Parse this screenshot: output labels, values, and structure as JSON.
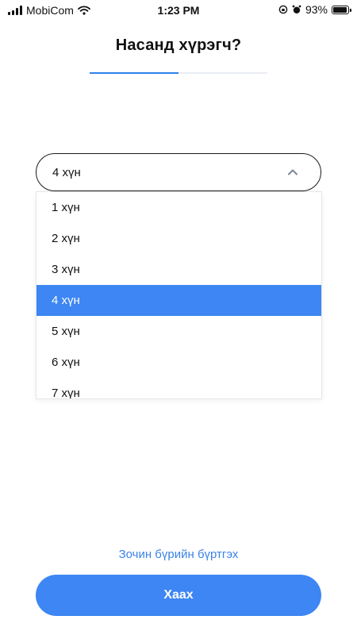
{
  "status_bar": {
    "carrier": "MobiCom",
    "time": "1:23 PM",
    "battery_percent": "93%",
    "battery_level": 0.93,
    "icons": [
      "signal-icon",
      "wifi-icon",
      "orientation-lock-icon",
      "alarm-icon",
      "battery-icon"
    ]
  },
  "header": {
    "title": "Насанд хүрэгч?",
    "progress_fraction": 0.5
  },
  "select": {
    "selected_value": "4 хүн",
    "options": [
      "1 хүн",
      "2 хүн",
      "3 хүн",
      "4 хүн",
      "5 хүн",
      "6 хүн",
      "7 хүн"
    ],
    "selected_index": 3
  },
  "footer": {
    "register_link": "Зочин бүрийн бүртгэх",
    "close_button": "Хаах"
  },
  "colors": {
    "accent": "#3d86f3",
    "link": "#3b82e8"
  }
}
